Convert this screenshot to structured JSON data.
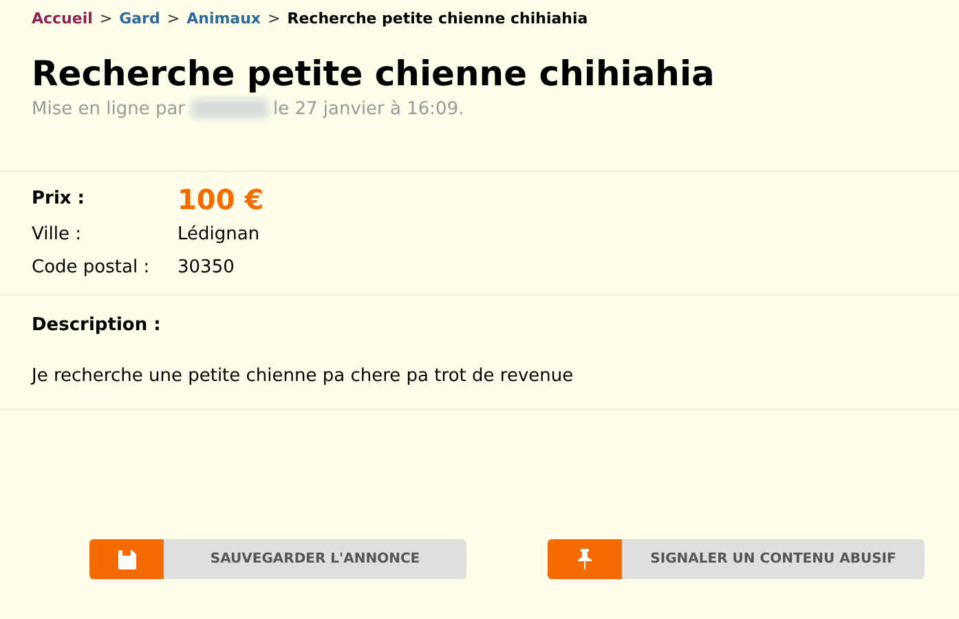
{
  "breadcrumb": [
    {
      "label": "Accueil",
      "kind": "home"
    },
    {
      "label": "Gard",
      "kind": "link"
    },
    {
      "label": "Animaux",
      "kind": "link"
    },
    {
      "label": "Recherche petite chienne chihiahia",
      "kind": "current"
    }
  ],
  "breadcrumb_separator": ">",
  "title": "Recherche petite chienne chihiahia",
  "meta": {
    "prefix": "Mise en ligne par",
    "suffix": "le 27 janvier à 16:09."
  },
  "details": [
    {
      "label": "Prix :",
      "value": "100 €",
      "kind": "price"
    },
    {
      "label": "Ville :",
      "value": "Lédignan",
      "kind": "plain"
    },
    {
      "label": "Code postal :",
      "value": "30350",
      "kind": "plain"
    }
  ],
  "description": {
    "label": "Description :",
    "text": "Je recherche une petite chienne pa chere pa trot de revenue"
  },
  "buttons": [
    {
      "label": "SAUVEGARDER L'ANNONCE",
      "kind": "save"
    },
    {
      "label": "SIGNALER UN CONTENU ABUSIF",
      "kind": "pin"
    }
  ]
}
